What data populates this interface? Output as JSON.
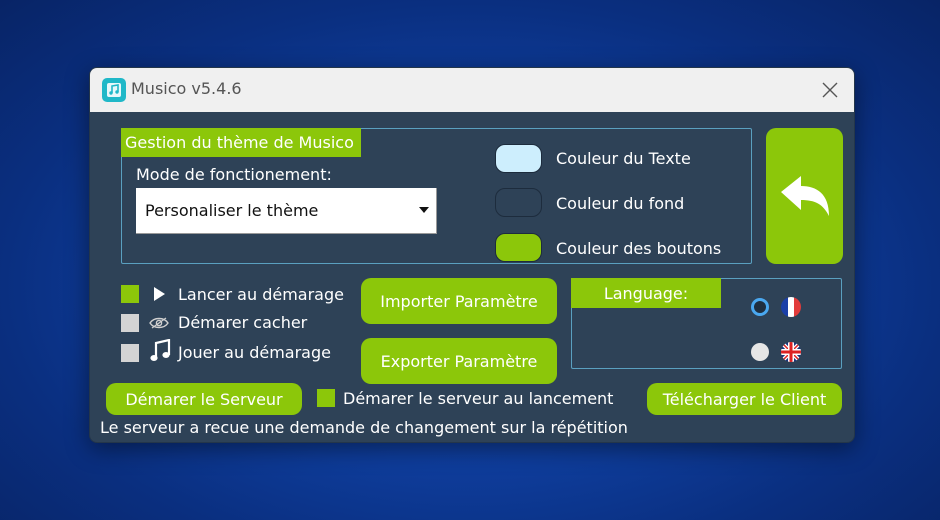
{
  "window": {
    "title": "Musico v5.4.6",
    "app_icon": "music-note-icon",
    "close_icon": "close-icon"
  },
  "theme": {
    "legend": "Gestion du thème de Musico",
    "mode_label": "Mode de fonctionement:",
    "mode_value": "Personaliser le thème",
    "colors": [
      {
        "label": "Couleur du Texte",
        "color": "#cdeefd"
      },
      {
        "label": "Couleur du fond",
        "color": "#2e4257"
      },
      {
        "label": "Couleur des boutons",
        "color": "#8cc70a"
      }
    ]
  },
  "back_button": {
    "icon": "undo-arrow-icon"
  },
  "options": [
    {
      "label": "Lancer au démarage",
      "checked": true,
      "icon": "play-icon"
    },
    {
      "label": "Démarer cacher",
      "checked": false,
      "icon": "eye-icon"
    },
    {
      "label": "Jouer au démarage",
      "checked": false,
      "icon": "music-note-icon"
    }
  ],
  "buttons": {
    "import": "Importer Paramètre",
    "export": "Exporter Paramètre",
    "start_server": "Démarer le Serveur",
    "download_client": "Télécharger le Client"
  },
  "language": {
    "legend": "Language:",
    "options": [
      {
        "flag": "france-flag-icon",
        "selected": true
      },
      {
        "flag": "uk-flag-icon",
        "selected": false
      }
    ]
  },
  "server_autostart": {
    "label": "Démarer le serveur au lancement",
    "checked": true
  },
  "status": "Le serveur a recue une demande de changement sur la répétition",
  "colors": {
    "accent": "#8cc70a",
    "panel_bg": "#2e4257",
    "border": "#5aa0c0",
    "unchecked": "#d4d4d4"
  }
}
